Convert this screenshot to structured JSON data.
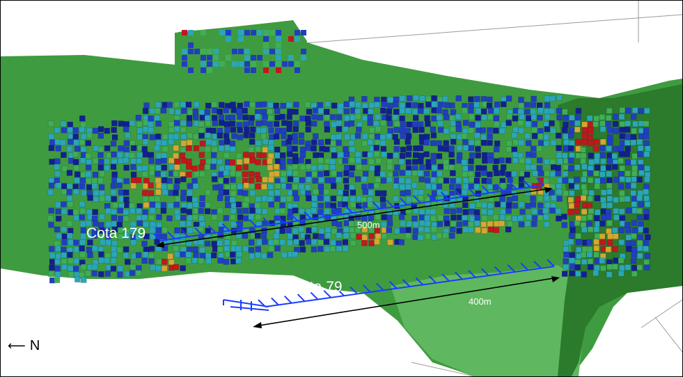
{
  "labels": {
    "upper_level": "Cota 179",
    "upper_length": "500m",
    "lower_level": "Cota 79",
    "lower_length": "400m",
    "north": "N"
  },
  "icons": {
    "north_arrow": "left-arrow-icon"
  },
  "colors": {
    "terrain": "#3f9b3f",
    "terrain_dark": "#2c7a2c",
    "terrain_light": "#5fb85f",
    "block_blue": "#1f3fbf",
    "block_navy": "#12208f",
    "block_cyan": "#2aa6b8",
    "block_green": "#3fae57",
    "block_yellow": "#d6a632",
    "block_red": "#c0181c",
    "tunnel": "#1a3cff",
    "dimension_line": "#000000"
  }
}
